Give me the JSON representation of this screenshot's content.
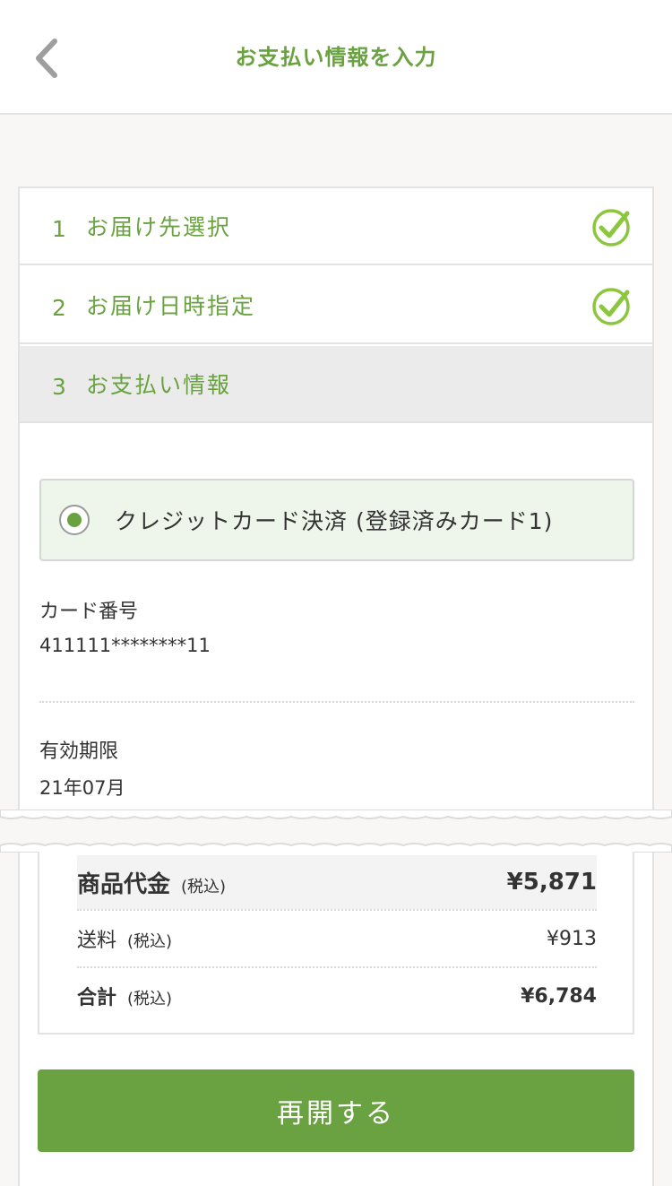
{
  "header": {
    "title": "お支払い情報を入力"
  },
  "steps": [
    {
      "number": "1",
      "label": "お届け先選択"
    },
    {
      "number": "2",
      "label": "お届け日時指定"
    },
    {
      "number": "3",
      "label": "お支払い情報"
    }
  ],
  "payment": {
    "option_label": "クレジットカード決済 (登録済みカード1)",
    "card_number_label": "カード番号",
    "card_number": "411111********11",
    "expiry_label": "有効期限",
    "expiry": "21年07月"
  },
  "summary": {
    "subtotal_label": "商品代金",
    "subtotal_tax": "(税込)",
    "subtotal": "¥5,871",
    "shipping_label": "送料",
    "shipping_tax": "(税込)",
    "shipping": "¥913",
    "total_label": "合計",
    "total_tax": "(税込)",
    "total": "¥6,784"
  },
  "actions": {
    "resume_label": "再開する"
  },
  "colors": {
    "accent": "#6aa241",
    "check": "#8cc63f",
    "selected_bg": "#eef5ea"
  },
  "icons": {
    "back": "chevron-left-icon",
    "check": "check-circle-icon"
  }
}
